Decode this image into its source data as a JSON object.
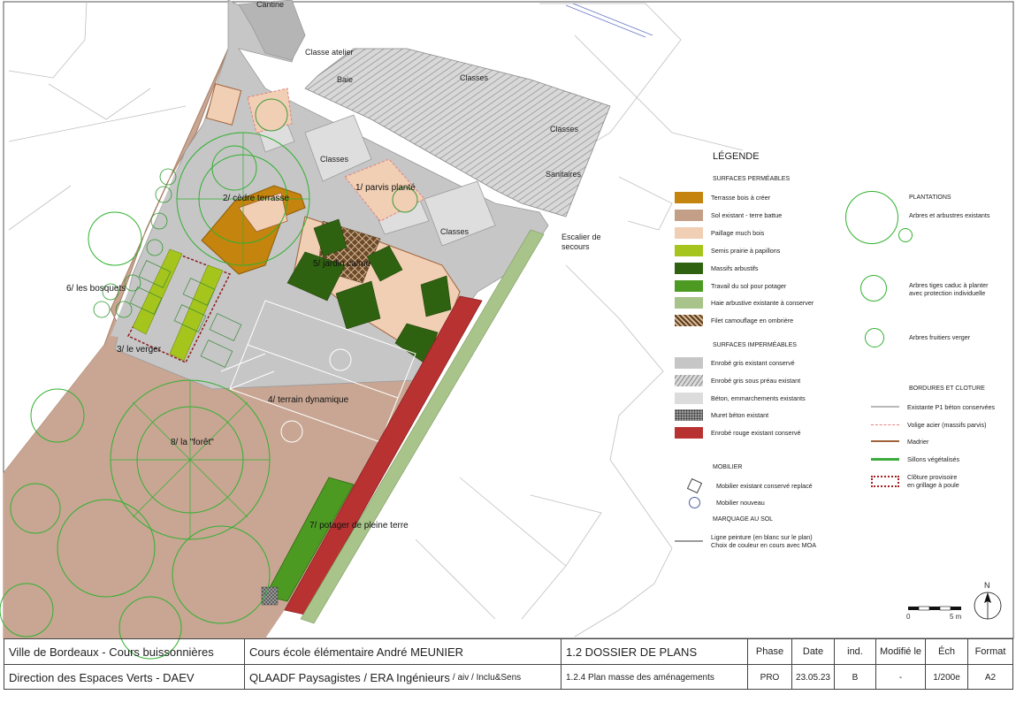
{
  "plan": {
    "building_labels": {
      "cantine": "Cantine",
      "classe_atelier": "Classe atelier",
      "baie": "Baie",
      "classes_top": "Classes",
      "classes_right": "Classes",
      "classes_mid": "Classes",
      "classes_low": "Classes",
      "sanitaires": "Sanitaires",
      "escalier_line1": "Escalier de",
      "escalier_line2": "secours"
    },
    "zones": {
      "z1": "1/ parvis planté",
      "z2": "2/ cèdre terrasse",
      "z3": "3/ le verger",
      "z4": "4/ terrain dynamique",
      "z5": "5/ jardin calme",
      "z6": "6/ les bosquets",
      "z7": "7/ potager de pleine terre",
      "z8": "8/ la \"forêt\""
    },
    "north": "N",
    "scale_zero": "0",
    "scale_five": "5 m"
  },
  "legend": {
    "title": "LÉGENDE",
    "permeable": {
      "heading": "SURFACES PERMÉABLES",
      "items": [
        {
          "label": "Terrasse bois à créer",
          "color": "#c4840e"
        },
        {
          "label": "Sol existant - terre battue",
          "color": "#c49f88"
        },
        {
          "label": "Paillage much bois",
          "color": "#f1cfb4"
        },
        {
          "label": "Semis prairie à papillons",
          "color": "#a6c51c"
        },
        {
          "label": "Massifs arbustifs",
          "color": "#2f6210"
        },
        {
          "label": "Travail du sol pour potager",
          "color": "#4d9a22"
        },
        {
          "label": "Haie arbustive existante à conserver",
          "color": "#a8c48a"
        },
        {
          "label": "Filet camouflage en ombrière",
          "color": "pattern"
        }
      ]
    },
    "impermeable": {
      "heading": "SURFACES IMPERMÉABLES",
      "items": [
        {
          "label": "Enrobé gris existant conservé",
          "color": "#c6c6c6"
        },
        {
          "label": "Enrobé gris sous préau existant",
          "color": "hatch"
        },
        {
          "label": "Béton, emmarchements existants",
          "color": "#dcdcdc"
        },
        {
          "label": "Muret béton existant",
          "color": "dots"
        },
        {
          "label": "Enrobé rouge existant conservé",
          "color": "#b83232"
        }
      ]
    },
    "mobilier": {
      "heading": "MOBILIER",
      "items": [
        "Mobilier existant conservé replacé",
        "Mobilier nouveau"
      ]
    },
    "marquage": {
      "heading": "MARQUAGE AU SOL",
      "line1": "Ligne peinture (en blanc sur le plan)",
      "line2": "Choix de couleur en cours avec MOA"
    },
    "plantations": {
      "heading": "PLANTATIONS",
      "items": [
        "Arbres et arbustres existants",
        "Arbres tiges caduc à planter",
        "avec protection individuelle",
        "Arbres fruitiers verger"
      ]
    },
    "bordures": {
      "heading": "BORDURES ET CLOTURE",
      "items": [
        {
          "label": "Existante P1 béton conservées",
          "color": "#b8b8b8"
        },
        {
          "label": "Volige acier (massifs parvis)",
          "color": "#e88080"
        },
        {
          "label": "Madrier",
          "color": "#a0623a"
        },
        {
          "label": "Sillons végétalisés",
          "color": "#3cab3c"
        }
      ],
      "cloture_line1": "Clôture provisoire",
      "cloture_line2": "en grillage à poule"
    }
  },
  "cartouche": {
    "client1": "Ville de Bordeaux - Cours buissonnières",
    "client2": "Direction des Espaces Verts - DAEV",
    "project": "Cours école élémentaire André MEUNIER",
    "team_main": "QLAADF Paysagistes / ERA Ingénieurs",
    "team_sub": "/ aiv / Inclu&Sens",
    "dossier": "1.2 DOSSIER DE PLANS",
    "plan": "1.2.4 Plan masse des aménagements",
    "headers": {
      "phase": "Phase",
      "date": "Date",
      "ind": "ind.",
      "modif": "Modifié le",
      "ech": "Éch",
      "format": "Format"
    },
    "values": {
      "phase": "PRO",
      "date": "23.05.23",
      "ind": "B",
      "modif": "-",
      "ech": "1/200e",
      "format": "A2"
    }
  }
}
